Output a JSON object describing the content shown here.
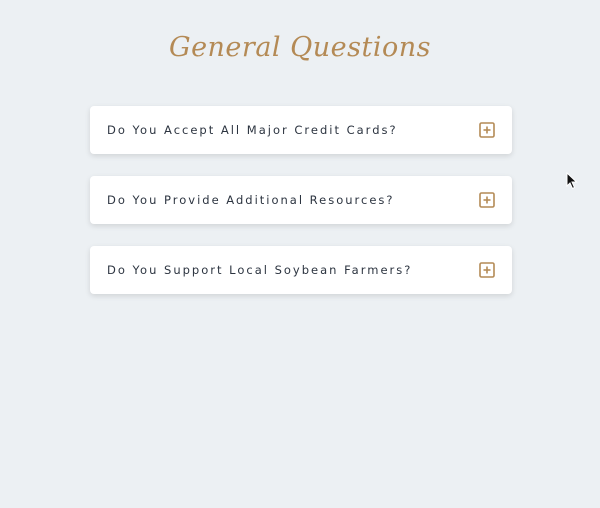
{
  "page": {
    "title": "General Questions"
  },
  "faq": {
    "items": [
      {
        "question": "Do You Accept All Major Credit Cards?",
        "icon": "plus-square-icon"
      },
      {
        "question": "Do You Provide Additional Resources?",
        "icon": "plus-square-icon"
      },
      {
        "question": "Do You Support Local Soybean Farmers?",
        "icon": "plus-square-icon"
      }
    ]
  },
  "colors": {
    "background": "#ecf0f3",
    "accent": "#b48a55",
    "card": "#ffffff",
    "text": "#2c3440"
  }
}
